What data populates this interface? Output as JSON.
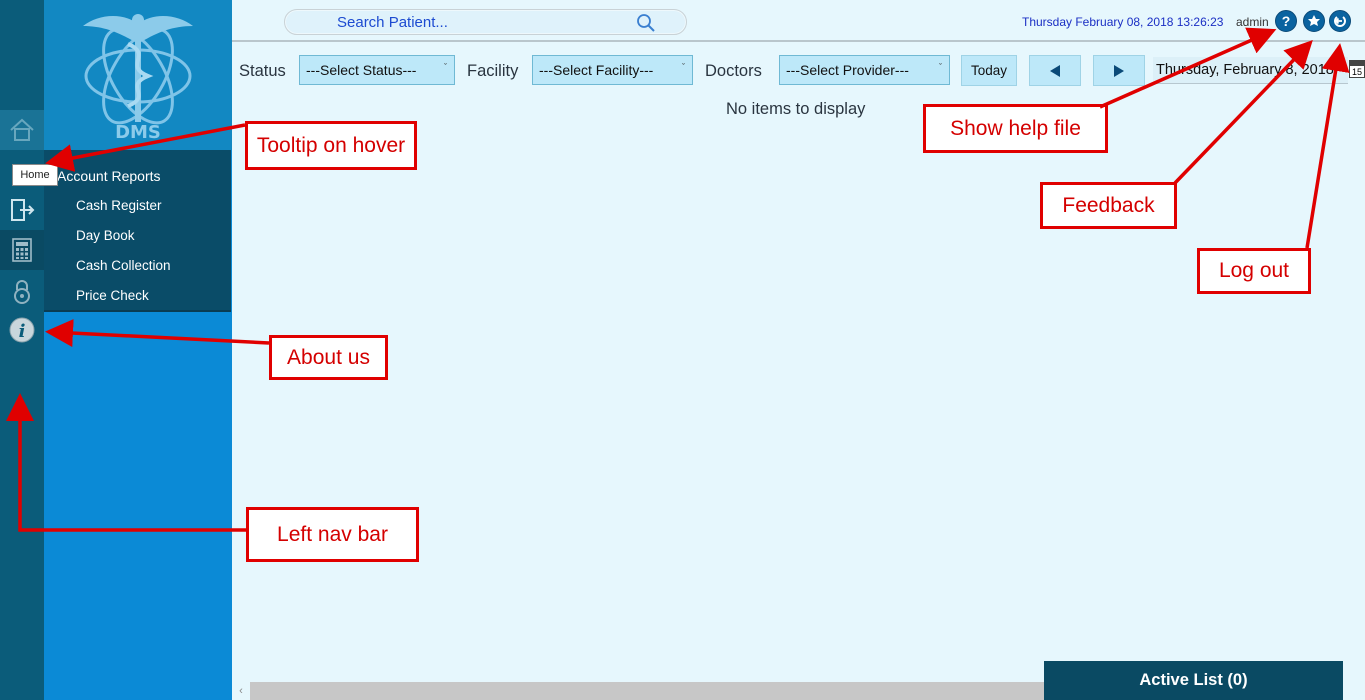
{
  "nav_rail": {
    "items": [
      {
        "name": "home",
        "icon": "home-icon"
      },
      {
        "name": "exit",
        "icon": "exit-icon"
      },
      {
        "name": "calculator",
        "icon": "calculator-icon"
      },
      {
        "name": "lock",
        "icon": "lock-icon"
      },
      {
        "name": "info",
        "icon": "info-icon"
      }
    ]
  },
  "brand": {
    "logo_text": "DMS"
  },
  "tooltip": {
    "text": "Home"
  },
  "submenu": {
    "heading": "Account Reports",
    "items": [
      "Cash Register",
      "Day Book",
      "Cash Collection",
      "Price Check"
    ]
  },
  "topbar": {
    "search_placeholder": "Search Patient...",
    "datetime": "Thursday February 08, 2018 13:26:23",
    "user": "admin"
  },
  "filters": {
    "status_label": "Status",
    "status_value": "---Select Status---",
    "facility_label": "Facility",
    "facility_value": "---Select Facility---",
    "doctors_label": "Doctors",
    "doctors_value": "---Select Provider---",
    "today_label": "Today",
    "date_value": "Thursday, February 8, 2018",
    "calendar_day": "15"
  },
  "content": {
    "empty_message": "No items to display"
  },
  "active_list": {
    "label": "Active List (0)"
  },
  "annotations": {
    "tooltip": "Tooltip on hover",
    "about": "About us",
    "leftnav": "Left nav bar",
    "help": "Show help file",
    "feedback": "Feedback",
    "logout": "Log out"
  },
  "colors": {
    "rail": "#0b5c7a",
    "panel": "#0b8ad6",
    "submenu": "#0a4c68",
    "annotation": "#e00000",
    "datetime": "#1b2fc4"
  }
}
